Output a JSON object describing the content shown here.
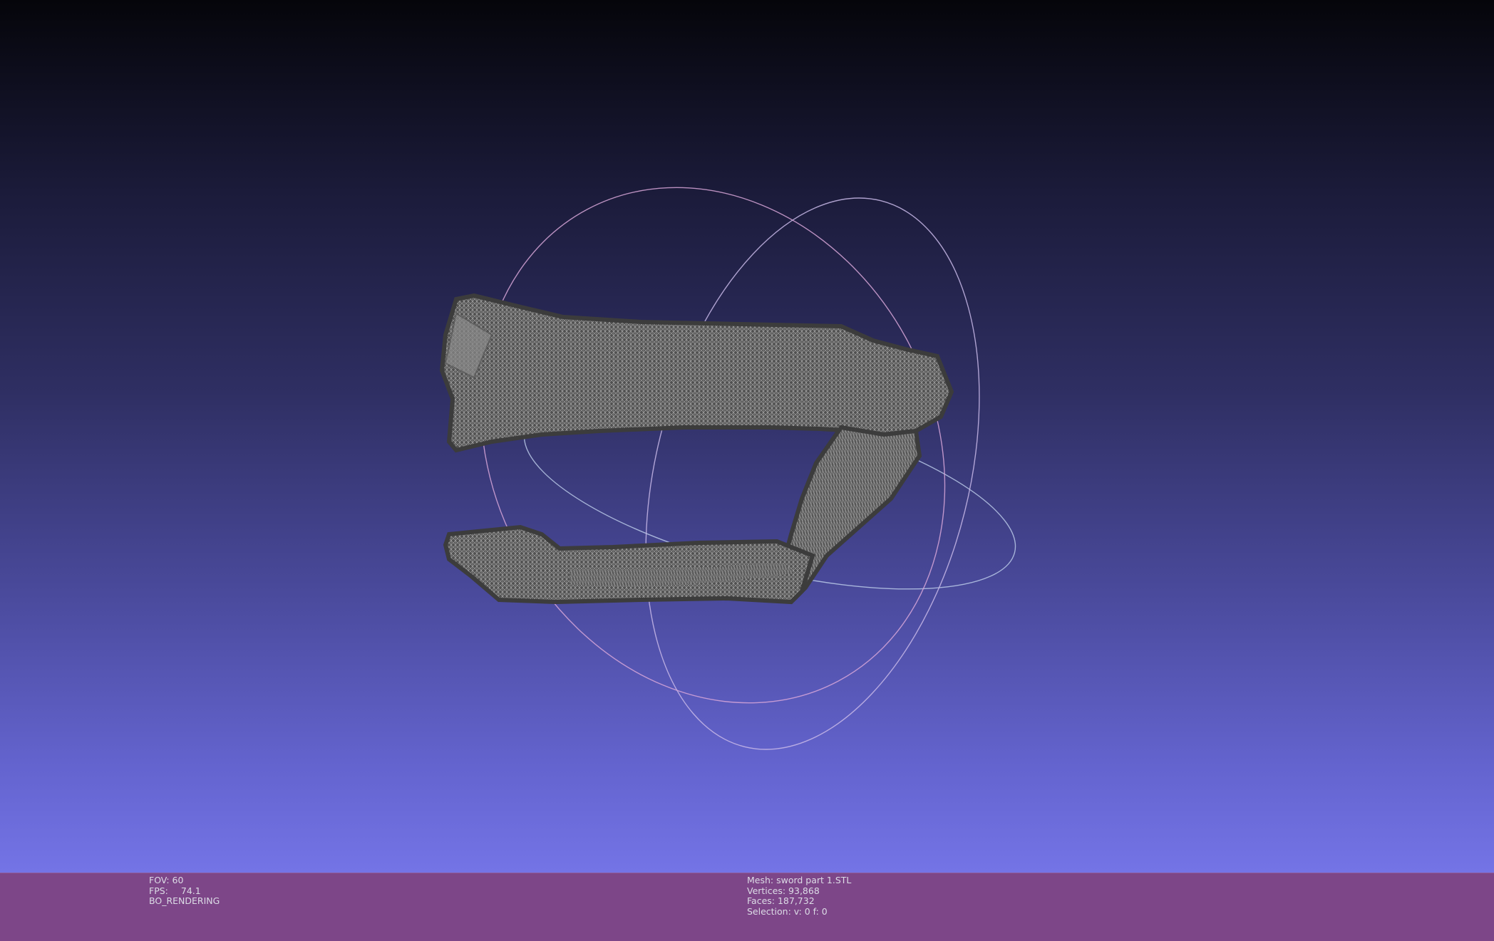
{
  "viewer": {
    "left_info": {
      "fov": "FOV: 60",
      "fps_label": "FPS:",
      "fps_value": "74.1",
      "render_mode": "BO_RENDERING"
    },
    "right_info": {
      "mesh": "Mesh: sword part 1.STL",
      "vertices": "Vertices: 93,868",
      "faces": "Faces: 187,732",
      "selection": "Selection: v: 0 f: 0"
    }
  },
  "colors": {
    "background_top": "#05050a",
    "background_bottom": "#7474e6",
    "info_bar": "#7d4688",
    "mesh": "#4a4a4a",
    "mesh_wire": "#bdbdbd",
    "trackball": "#c7b2d8"
  },
  "icons": {
    "trackball": "trackball-gizmo",
    "model": "mesh-model"
  }
}
